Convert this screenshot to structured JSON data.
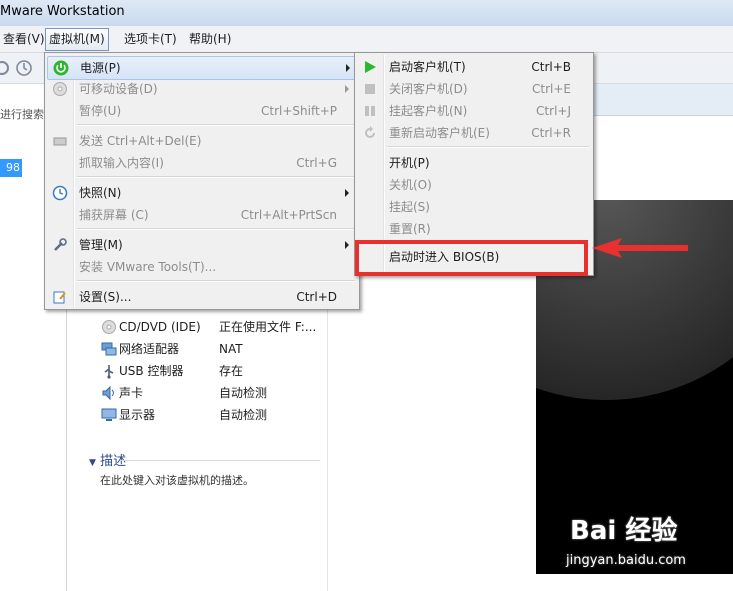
{
  "window": {
    "title": "Mware Workstation"
  },
  "menubar": {
    "items": [
      "查看(V)",
      "虚拟机(M)",
      "选项卡(T)",
      "帮助(H)"
    ]
  },
  "leftpane": {
    "search_placeholder": "进行搜索",
    "selected_vm_suffix": "98"
  },
  "vm_menu": {
    "items": [
      {
        "label": "电源(P)",
        "shortcut": "",
        "submenu": true,
        "disabled": false,
        "icon": "power-icon"
      },
      {
        "label": "可移动设备(D)",
        "shortcut": "",
        "submenu": true,
        "disabled": true,
        "icon": "cd-icon"
      },
      {
        "label": "暂停(U)",
        "shortcut": "Ctrl+Shift+P",
        "submenu": false,
        "disabled": true,
        "icon": ""
      },
      {
        "label": "发送 Ctrl+Alt+Del(E)",
        "shortcut": "",
        "submenu": false,
        "disabled": true,
        "icon": "keyboard-icon"
      },
      {
        "label": "抓取输入内容(I)",
        "shortcut": "Ctrl+G",
        "submenu": false,
        "disabled": true,
        "icon": ""
      },
      {
        "label": "快照(N)",
        "shortcut": "",
        "submenu": true,
        "disabled": false,
        "icon": "snapshot-icon"
      },
      {
        "label": "捕获屏幕 (C)",
        "shortcut": "Ctrl+Alt+PrtScn",
        "submenu": false,
        "disabled": true,
        "icon": ""
      },
      {
        "label": "管理(M)",
        "shortcut": "",
        "submenu": true,
        "disabled": false,
        "icon": "wrench-icon"
      },
      {
        "label": "安装 VMware Tools(T)...",
        "shortcut": "",
        "submenu": false,
        "disabled": true,
        "icon": ""
      },
      {
        "label": "设置(S)...",
        "shortcut": "Ctrl+D",
        "submenu": false,
        "disabled": false,
        "icon": "settings-icon"
      }
    ]
  },
  "power_menu": {
    "items": [
      {
        "label": "启动客户机(T)",
        "shortcut": "Ctrl+B",
        "disabled": false,
        "icon": "play-icon"
      },
      {
        "label": "关闭客户机(D)",
        "shortcut": "Ctrl+E",
        "disabled": true,
        "icon": "stop-icon"
      },
      {
        "label": "挂起客户机(N)",
        "shortcut": "Ctrl+J",
        "disabled": true,
        "icon": "pause-icon"
      },
      {
        "label": "重新启动客户机(E)",
        "shortcut": "Ctrl+R",
        "disabled": true,
        "icon": "restart-icon"
      },
      {
        "label": "开机(P)",
        "shortcut": "",
        "disabled": false,
        "icon": ""
      },
      {
        "label": "关机(O)",
        "shortcut": "",
        "disabled": true,
        "icon": ""
      },
      {
        "label": "挂起(S)",
        "shortcut": "",
        "disabled": true,
        "icon": ""
      },
      {
        "label": "重置(R)",
        "shortcut": "",
        "disabled": true,
        "icon": ""
      },
      {
        "label": "启动时进入 BIOS(B)",
        "shortcut": "",
        "disabled": false,
        "icon": ""
      }
    ]
  },
  "hardware": [
    {
      "name": "CD/DVD (IDE)",
      "value": "正在使用文件 F:...",
      "icon": "cd-icon"
    },
    {
      "name": "网络适配器",
      "value": "NAT",
      "icon": "network-icon"
    },
    {
      "name": "USB 控制器",
      "value": "存在",
      "icon": "usb-icon"
    },
    {
      "name": "声卡",
      "value": "自动检测",
      "icon": "speaker-icon"
    },
    {
      "name": "显示器",
      "value": "自动检测",
      "icon": "monitor-icon"
    }
  ],
  "description": {
    "title": "描述",
    "placeholder": "在此处键入对该虚拟机的描述。"
  },
  "watermark": {
    "logo": "Bai 经验",
    "url": "jingyan.baidu.com"
  },
  "colors": {
    "annotation": "#e8312e",
    "selection": "#3399ff",
    "play": "#2db52d"
  }
}
